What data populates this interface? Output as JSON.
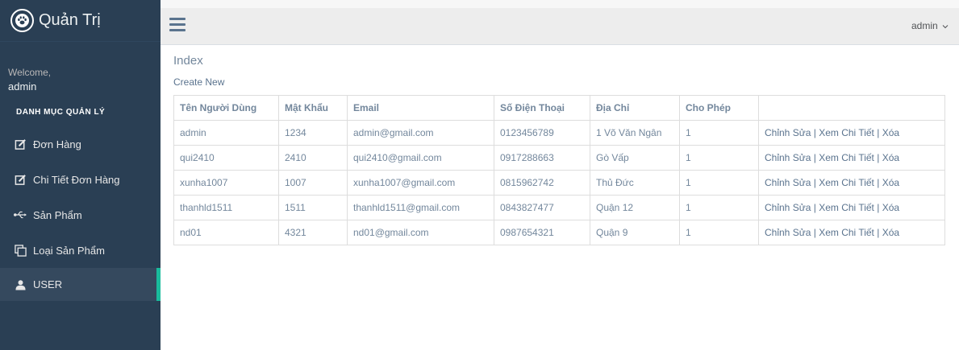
{
  "brand": {
    "title": "Quản Trị",
    "icon": "paw-icon"
  },
  "profile": {
    "welcome_label": "Welcome,",
    "name": "admin"
  },
  "sidebar": {
    "section_title": "DANH MỤC QUẢN LÝ",
    "items": [
      {
        "label": "Đơn Hàng",
        "icon": "edit-icon"
      },
      {
        "label": "Chi Tiết Đơn Hàng",
        "icon": "edit-icon"
      },
      {
        "label": "Sản Phẩm",
        "icon": "usb-icon"
      },
      {
        "label": "Loại Sản Phẩm",
        "icon": "clone-icon"
      },
      {
        "label": "USER",
        "icon": "user-icon"
      }
    ],
    "active_index": 4
  },
  "topbar": {
    "user_label": "admin"
  },
  "page": {
    "title": "Index",
    "create_link": "Create New"
  },
  "table": {
    "headers": [
      "Tên Người Dùng",
      "Mật Khẩu",
      "Email",
      "Số Điện Thoại",
      "Địa Chỉ",
      "Cho Phép",
      ""
    ],
    "rows": [
      {
        "username": "admin",
        "password": "1234",
        "email": "admin@gmail.com",
        "phone": "0123456789",
        "address": "1 Võ Văn Ngân",
        "permission": "1"
      },
      {
        "username": "qui2410",
        "password": "2410",
        "email": "qui2410@gmail.com",
        "phone": "0917288663",
        "address": "Gò Vấp",
        "permission": "1"
      },
      {
        "username": "xunha1007",
        "password": "1007",
        "email": "xunha1007@gmail.com",
        "phone": "0815962742",
        "address": "Thủ Đức",
        "permission": "1"
      },
      {
        "username": "thanhld1511",
        "password": "1511",
        "email": "thanhld1511@gmail.com",
        "phone": "0843827477",
        "address": "Quận 12",
        "permission": "1"
      },
      {
        "username": "nd01",
        "password": "4321",
        "email": "nd01@gmail.com",
        "phone": "0987654321",
        "address": "Quận 9",
        "permission": "1"
      }
    ],
    "actions": {
      "edit": "Chỉnh Sửa",
      "details": "Xem Chi Tiết",
      "delete": "Xóa",
      "separator": " | "
    }
  },
  "colors": {
    "sidebar_bg": "#2a3f54",
    "accent": "#1abb9c",
    "text": "#73879c"
  }
}
